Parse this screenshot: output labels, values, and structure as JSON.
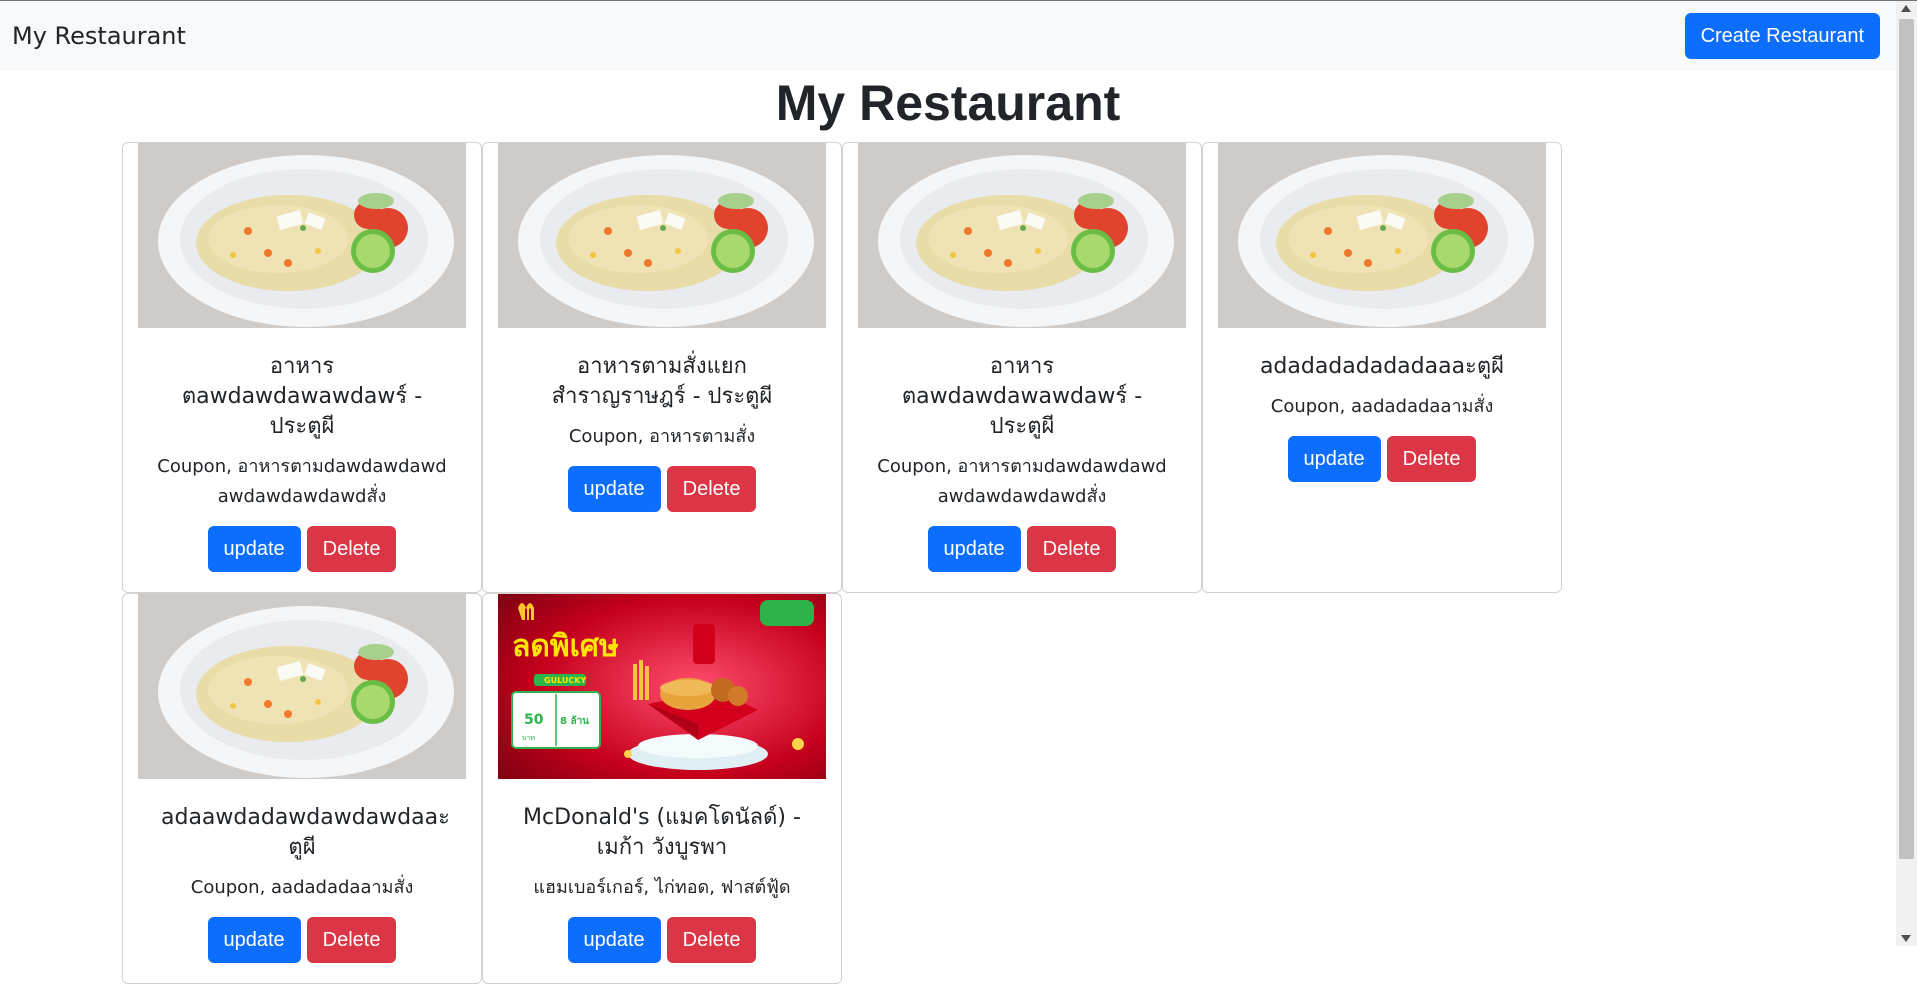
{
  "navbar": {
    "brand": "My Restaurant",
    "create_label": "Create Restaurant"
  },
  "page_title": "My Restaurant",
  "cards": [
    {
      "name": "อาหารตawdawdawawdawร์ - ประตูผี",
      "categories": "Coupon, อาหารตามdawdawdawdawdawdawdawdสั่ง",
      "image": "fried-rice-plate",
      "update_label": "update",
      "delete_label": "Delete"
    },
    {
      "name": "อาหารตามสั่งแยกสำราญราษฎร์ - ประตูผี",
      "categories": "Coupon, อาหารตามสั่ง",
      "image": "fried-rice-plate",
      "update_label": "update",
      "delete_label": "Delete"
    },
    {
      "name": "อาหารตawdawdawawdawร์ - ประตูผี",
      "categories": "Coupon, อาหารตามdawdawdawdawdawdawdawdสั่ง",
      "image": "fried-rice-plate",
      "update_label": "update",
      "delete_label": "Delete"
    },
    {
      "name": "adadadadadadaaaะตูผี",
      "categories": "Coupon, aadadadaaามสั่ง",
      "image": "fried-rice-plate",
      "update_label": "update",
      "delete_label": "Delete"
    },
    {
      "name": "adaawdadawdawdawdaaะตูผี",
      "categories": "Coupon, aadadadaaามสั่ง",
      "image": "fried-rice-plate",
      "update_label": "update",
      "delete_label": "Delete"
    },
    {
      "name": "McDonald's (แมคโดนัลด์) - เมก้า วังบูรพา",
      "categories": "แฮมเบอร์เกอร์, ไก่ทอด, ฟาสต์ฟู้ด",
      "image": "mcdonalds-promo-banner",
      "promo_text": "ลดพิเศษ",
      "promo_code": "GULUCKY",
      "promo_value_1": "50",
      "promo_value_2": "8 ล้าน",
      "promo_unit": "บาท",
      "update_label": "update",
      "delete_label": "Delete"
    }
  ],
  "colors": {
    "primary": "#0d6efd",
    "danger": "#dc3545",
    "navbar_bg": "#f8f9fa"
  }
}
